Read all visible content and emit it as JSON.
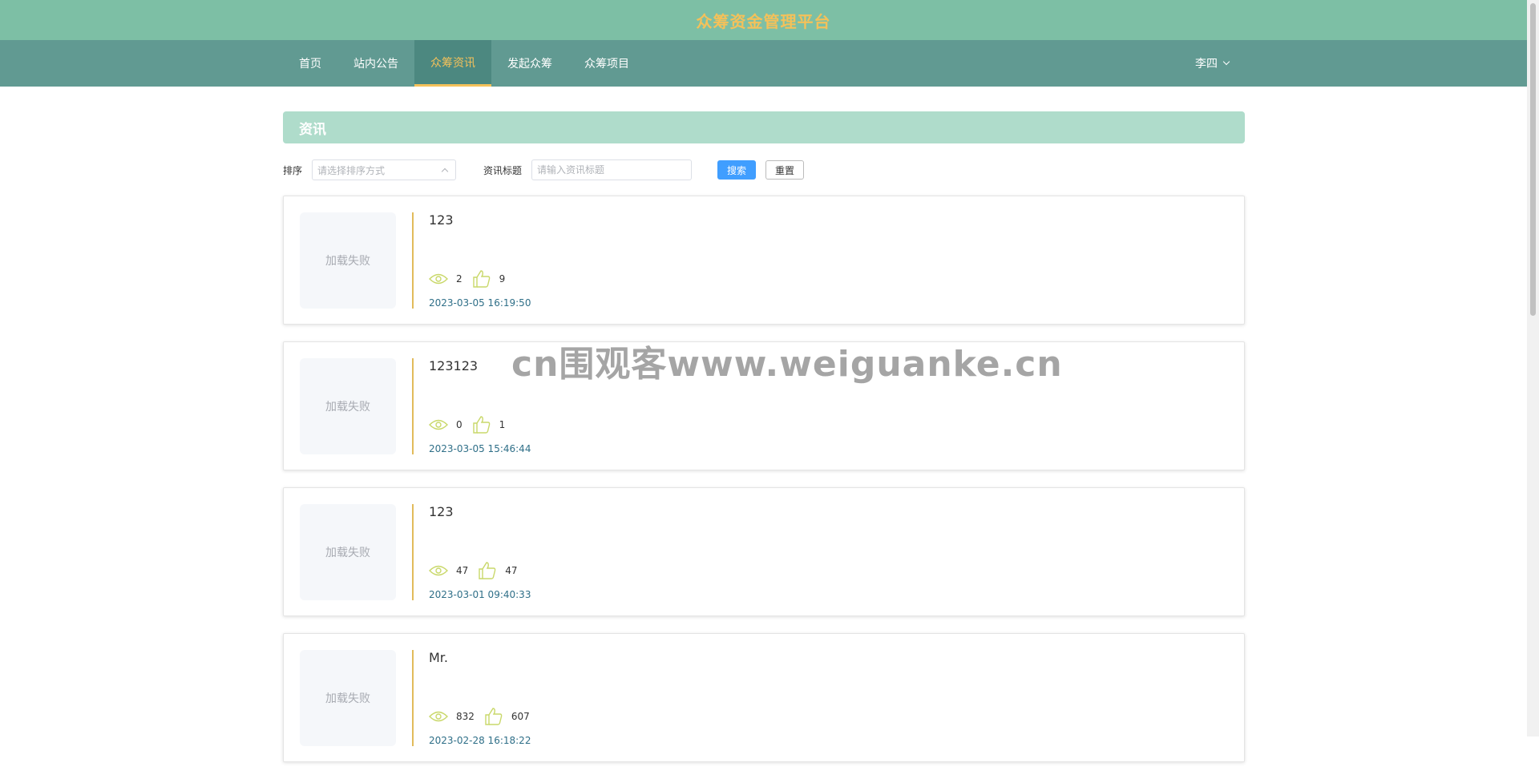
{
  "site": {
    "title": "众筹资金管理平台"
  },
  "nav": {
    "items": [
      {
        "label": "首页",
        "active": false
      },
      {
        "label": "站内公告",
        "active": false
      },
      {
        "label": "众筹资讯",
        "active": true
      },
      {
        "label": "发起众筹",
        "active": false
      },
      {
        "label": "众筹项目",
        "active": false
      }
    ],
    "user": "李四"
  },
  "section": {
    "title": "资讯"
  },
  "filters": {
    "sort_label": "排序",
    "sort_placeholder": "请选择排序方式",
    "title_label": "资讯标题",
    "title_placeholder": "请输入资讯标题",
    "search_button": "搜索",
    "reset_button": "重置"
  },
  "news": [
    {
      "image_text": "加载失败",
      "title": "123",
      "views": "2",
      "likes": "9",
      "date": "2023-03-05 16:19:50"
    },
    {
      "image_text": "加载失败",
      "title": "123123",
      "views": "0",
      "likes": "1",
      "date": "2023-03-05 15:46:44"
    },
    {
      "image_text": "加载失败",
      "title": "123",
      "views": "47",
      "likes": "47",
      "date": "2023-03-01 09:40:33"
    },
    {
      "image_text": "加载失败",
      "title": "Mr.",
      "views": "832",
      "likes": "607",
      "date": "2023-02-28 16:18:22"
    }
  ],
  "watermark": "cn围观客www.weiguanke.cn",
  "colors": {
    "topbar": "#7dbfa5",
    "navbar": "#619a92",
    "accent": "#f4c15a",
    "section_header": "#afdccb",
    "icon": "#c9d86a"
  }
}
